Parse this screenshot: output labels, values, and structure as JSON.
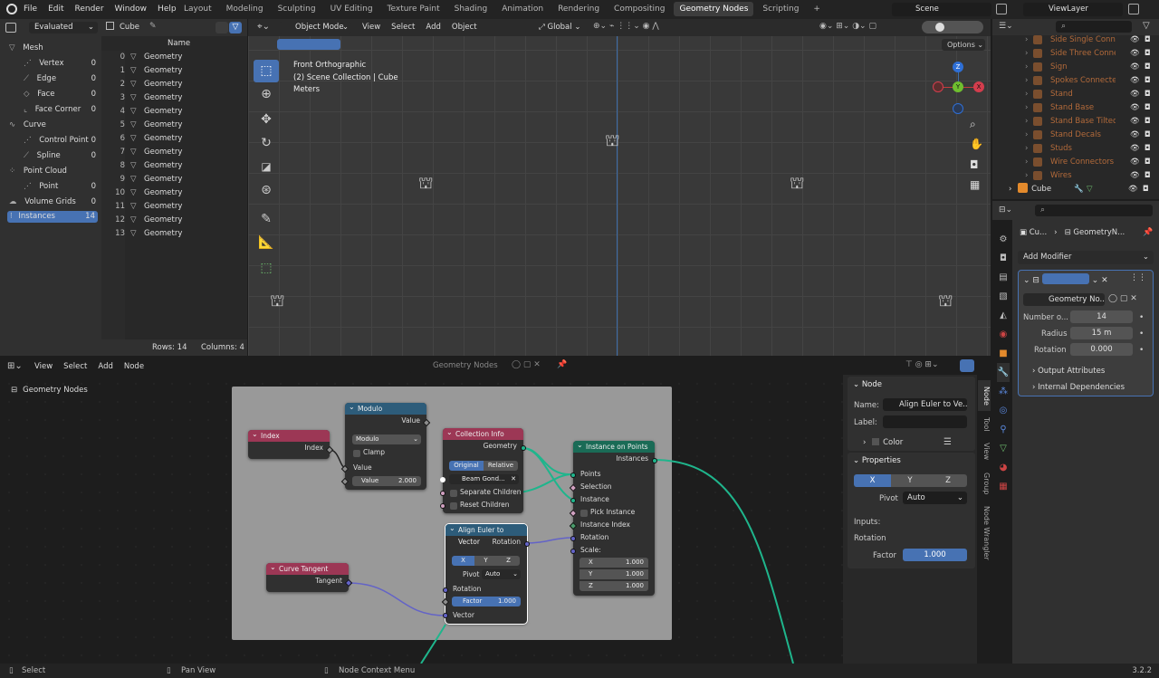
{
  "topbar": {
    "menus": [
      "File",
      "Edit",
      "Render",
      "Window",
      "Help"
    ],
    "tabs": [
      "Layout",
      "Modeling",
      "Sculpting",
      "UV Editing",
      "Texture Paint",
      "Shading",
      "Animation",
      "Rendering",
      "Compositing",
      "Geometry Nodes",
      "Scripting"
    ],
    "active_tab": "Geometry Nodes",
    "scene": "Scene",
    "view_layer": "ViewLayer"
  },
  "spreadsheet": {
    "mode": "Evaluated",
    "object": "Cube",
    "column_header": "Name",
    "tree": [
      {
        "label": "Mesh",
        "count": ""
      },
      {
        "label": "Vertex",
        "count": "0"
      },
      {
        "label": "Edge",
        "count": "0"
      },
      {
        "label": "Face",
        "count": "0"
      },
      {
        "label": "Face Corner",
        "count": "0"
      },
      {
        "label": "Curve",
        "count": ""
      },
      {
        "label": "Control Point",
        "count": "0"
      },
      {
        "label": "Spline",
        "count": "0"
      },
      {
        "label": "Point Cloud",
        "count": ""
      },
      {
        "label": "Point",
        "count": "0"
      },
      {
        "label": "Volume Grids",
        "count": "0"
      },
      {
        "label": "Instances",
        "count": "14"
      }
    ],
    "rows": [
      "Geometry",
      "Geometry",
      "Geometry",
      "Geometry",
      "Geometry",
      "Geometry",
      "Geometry",
      "Geometry",
      "Geometry",
      "Geometry",
      "Geometry",
      "Geometry",
      "Geometry",
      "Geometry"
    ],
    "row_indices": [
      "0",
      "1",
      "2",
      "3",
      "4",
      "5",
      "6",
      "7",
      "8",
      "9",
      "10",
      "11",
      "12",
      "13"
    ],
    "footer_rows": "Rows: 14",
    "footer_cols": "Columns: 4"
  },
  "viewport": {
    "mode": "Object Mode",
    "menus": [
      "View",
      "Select",
      "Add",
      "Object"
    ],
    "orientation": "Global",
    "options": "Options",
    "info1": "Front Orthographic",
    "info2": "(2) Scene Collection | Cube",
    "info3": "Meters",
    "gizmo": {
      "z": "Z",
      "y": "Y",
      "x": "X"
    }
  },
  "node_editor": {
    "menus": [
      "View",
      "Select",
      "Add",
      "Node"
    ],
    "tree_name": "Geometry Nodes",
    "breadcrumb": "Geometry Nodes",
    "nodes": {
      "index": {
        "title": "Index",
        "out": "Index"
      },
      "modulo": {
        "title": "Modulo",
        "out": "Value",
        "op": "Modulo",
        "clamp": "Clamp",
        "in": "Value",
        "field_label": "Value",
        "field_value": "2.000"
      },
      "collection": {
        "title": "Collection Info",
        "out": "Geometry",
        "opt1": "Original",
        "opt2": "Relative",
        "coll": "Beam Gond...",
        "sep": "Separate Children",
        "reset": "Reset Children"
      },
      "align": {
        "title": "Align Euler to Vector",
        "out": "Rotation",
        "x": "X",
        "y": "Y",
        "z": "Z",
        "pivot_label": "Pivot",
        "pivot": "Auto",
        "rot": "Rotation",
        "factor_label": "Factor",
        "factor": "1.000",
        "vector": "Vector"
      },
      "tangent": {
        "title": "Curve Tangent",
        "out": "Tangent"
      },
      "instance": {
        "title": "Instance on Points",
        "out": "Instances",
        "points": "Points",
        "selection": "Selection",
        "instance": "Instance",
        "pick": "Pick Instance",
        "idx": "Instance Index",
        "rotation": "Rotation",
        "scale": "Scale:",
        "sx": "X",
        "sy": "Y",
        "sz": "Z",
        "sxv": "1.000",
        "syv": "1.000",
        "szv": "1.000"
      }
    },
    "sidebar": {
      "node_title": "Node",
      "name_label": "Name:",
      "name": "Align Euler to Ve...",
      "label_label": "Label:",
      "color": "Color",
      "props": "Properties",
      "x": "X",
      "y": "Y",
      "z": "Z",
      "pivot_label": "Pivot",
      "pivot": "Auto",
      "inputs": "Inputs:",
      "rotation": "Rotation",
      "factor_label": "Factor",
      "factor": "1.000",
      "tabs": [
        "Node",
        "Tool",
        "View",
        "Group",
        "Node Wrangler"
      ]
    }
  },
  "outliner": {
    "items": [
      "Side Single Conne",
      "Side Three Conne",
      "Sign",
      "Spokes Connecte",
      "Stand",
      "Stand Base",
      "Stand Base Tilted",
      "Stand Decals",
      "Studs",
      "Wire Connectors",
      "Wires"
    ],
    "active": "Cube"
  },
  "properties": {
    "path1": "Cu...",
    "path2": "GeometryN...",
    "add_modifier": "Add Modifier",
    "modifier_name": "Geometry No...",
    "fields": [
      {
        "label": "Number o...",
        "value": "14"
      },
      {
        "label": "Radius",
        "value": "15 m"
      },
      {
        "label": "Rotation",
        "value": "0.000"
      }
    ],
    "panels": [
      "Output Attributes",
      "Internal Dependencies"
    ]
  },
  "status": {
    "select": "Select",
    "pan": "Pan View",
    "context": "Node Context Menu",
    "version": "3.2.2"
  }
}
